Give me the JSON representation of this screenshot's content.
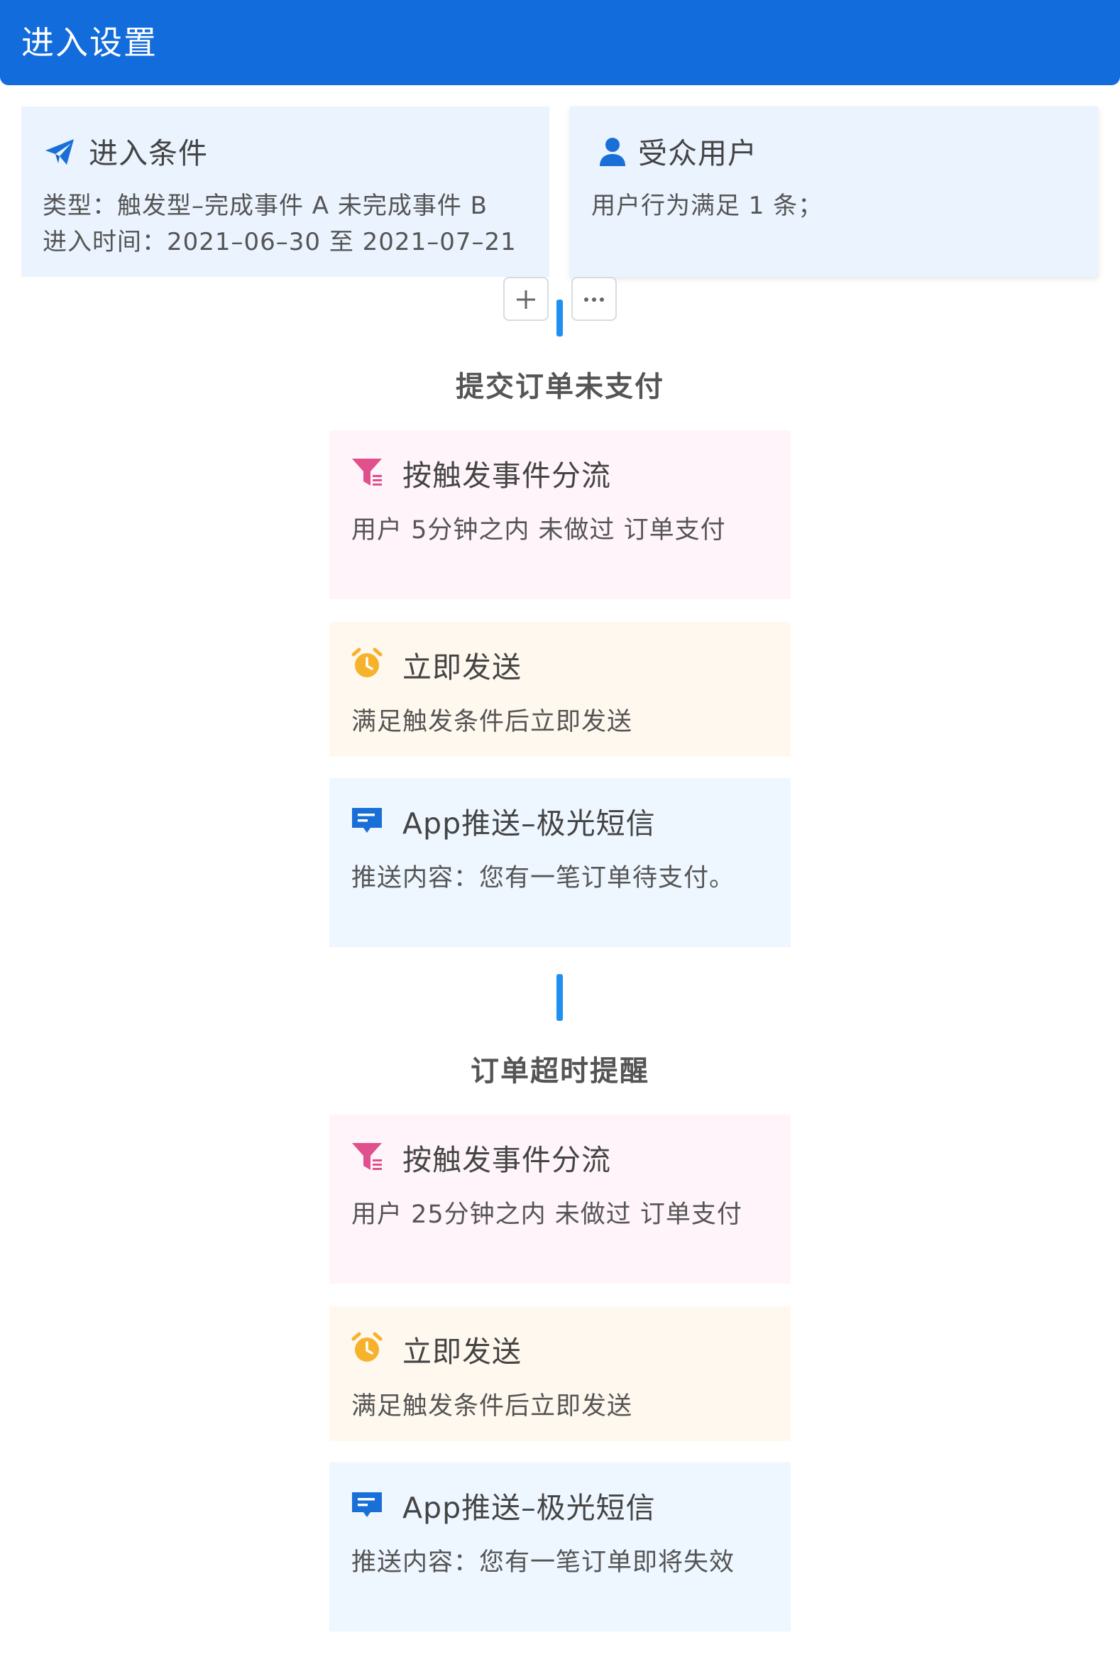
{
  "header": {
    "title": "进入设置"
  },
  "entry_conditions": {
    "title": "进入条件",
    "type_line": "类型：触发型–完成事件 A 未完成事件 B",
    "time_line": "进入时间：2021–06–30 至 2021–07–21"
  },
  "audience": {
    "title": "受众用户",
    "rule_line": "用户行为满足 1 条；"
  },
  "groups": [
    {
      "title": "提交订单未支付",
      "steps": [
        {
          "kind": "split",
          "icon": "funnel-icon",
          "title": "按触发事件分流",
          "desc": "用户 5分钟之内 未做过 订单支付"
        },
        {
          "kind": "timing",
          "icon": "alarm-clock-icon",
          "title": "立即发送",
          "desc": "满足触发条件后立即发送"
        },
        {
          "kind": "push",
          "icon": "message-icon",
          "title": "App推送–极光短信",
          "desc": "推送内容：您有一笔订单待支付。"
        }
      ]
    },
    {
      "title": "订单超时提醒",
      "steps": [
        {
          "kind": "split",
          "icon": "funnel-icon",
          "title": "按触发事件分流",
          "desc": "用户 25分钟之内 未做过 订单支付"
        },
        {
          "kind": "timing",
          "icon": "alarm-clock-icon",
          "title": "立即发送",
          "desc": "满足触发条件后立即发送"
        },
        {
          "kind": "push",
          "icon": "message-icon",
          "title": "App推送–极光短信",
          "desc": "推送内容：您有一笔订单即将失效"
        }
      ]
    }
  ],
  "colors": {
    "header": "#136cdb",
    "connector": "#1e90f0",
    "split_bg": "#fff4f9",
    "timing_bg": "#fff8ee",
    "push_bg": "#eef6ff",
    "funnel": "#e0508d",
    "clock": "#f7b22c",
    "message": "#1a6fd6"
  }
}
